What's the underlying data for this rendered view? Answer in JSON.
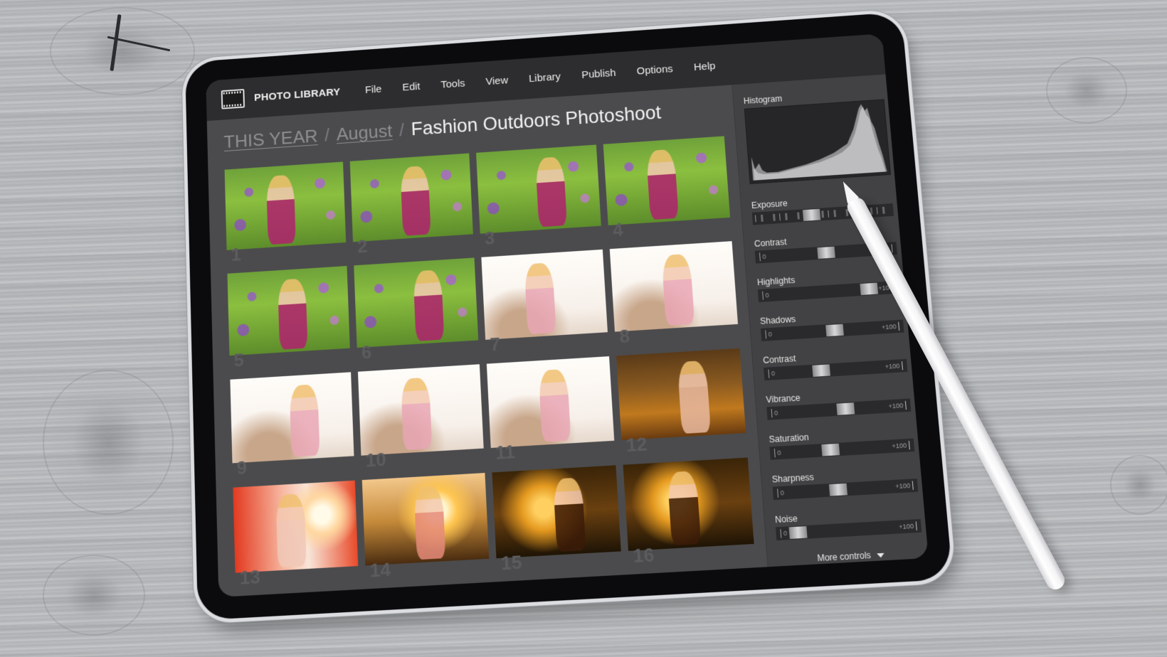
{
  "app": {
    "title": "PHOTO LIBRARY",
    "logo_icon": "film-strip-icon"
  },
  "menu": {
    "items": [
      {
        "label": "File"
      },
      {
        "label": "Edit"
      },
      {
        "label": "Tools"
      },
      {
        "label": "View"
      },
      {
        "label": "Library"
      },
      {
        "label": "Publish"
      },
      {
        "label": "Options"
      },
      {
        "label": "Help"
      }
    ]
  },
  "breadcrumb": {
    "items": [
      {
        "label": "THIS YEAR"
      },
      {
        "label": "August"
      }
    ],
    "separator": "/",
    "current": "Fashion Outdoors Photoshoot"
  },
  "thumbnails": [
    {
      "number": "1",
      "style": "green-field"
    },
    {
      "number": "2",
      "style": "green-field"
    },
    {
      "number": "3",
      "style": "green-field"
    },
    {
      "number": "4",
      "style": "green-field"
    },
    {
      "number": "5",
      "style": "green-field"
    },
    {
      "number": "6",
      "style": "green-field"
    },
    {
      "number": "7",
      "style": "white-beach"
    },
    {
      "number": "8",
      "style": "white-beach"
    },
    {
      "number": "9",
      "style": "white-beach"
    },
    {
      "number": "10",
      "style": "white-beach"
    },
    {
      "number": "11",
      "style": "white-beach"
    },
    {
      "number": "12",
      "style": "autumn-forest"
    },
    {
      "number": "13",
      "style": "sun-flare-red"
    },
    {
      "number": "14",
      "style": "sunset-meadow"
    },
    {
      "number": "15",
      "style": "dark-backlit"
    },
    {
      "number": "16",
      "style": "dark-backlit"
    }
  ],
  "panel": {
    "histogram_label": "Histogram",
    "controls": [
      {
        "label": "Exposure",
        "type": "ticked",
        "value_fraction": 0.42
      },
      {
        "label": "Contrast",
        "min": "0",
        "max": "+100",
        "value_fraction": 0.5
      },
      {
        "label": "Highlights",
        "min": "0",
        "max": "+100",
        "value_fraction": 0.78
      },
      {
        "label": "Shadows",
        "min": "0",
        "max": "+100",
        "value_fraction": 0.52
      },
      {
        "label": "Contrast",
        "min": "0",
        "max": "+100",
        "value_fraction": 0.4
      },
      {
        "label": "Vibrance",
        "min": "0",
        "max": "+100",
        "value_fraction": 0.55
      },
      {
        "label": "Saturation",
        "min": "0",
        "max": "+100",
        "value_fraction": 0.42
      },
      {
        "label": "Sharpness",
        "min": "0",
        "max": "+100",
        "value_fraction": 0.45
      },
      {
        "label": "Noise",
        "min": "0",
        "max": "+100",
        "value_fraction": 0.15
      }
    ],
    "more_controls_label": "More controls",
    "more_controls_icon": "caret-down-icon"
  },
  "colors": {
    "menubar_bg": "#2d2d2f",
    "screen_bg": "#4b4b4d",
    "panel_bg": "#424244",
    "text_primary": "#f2f2f2",
    "breadcrumb_muted": "#8e8e90"
  }
}
